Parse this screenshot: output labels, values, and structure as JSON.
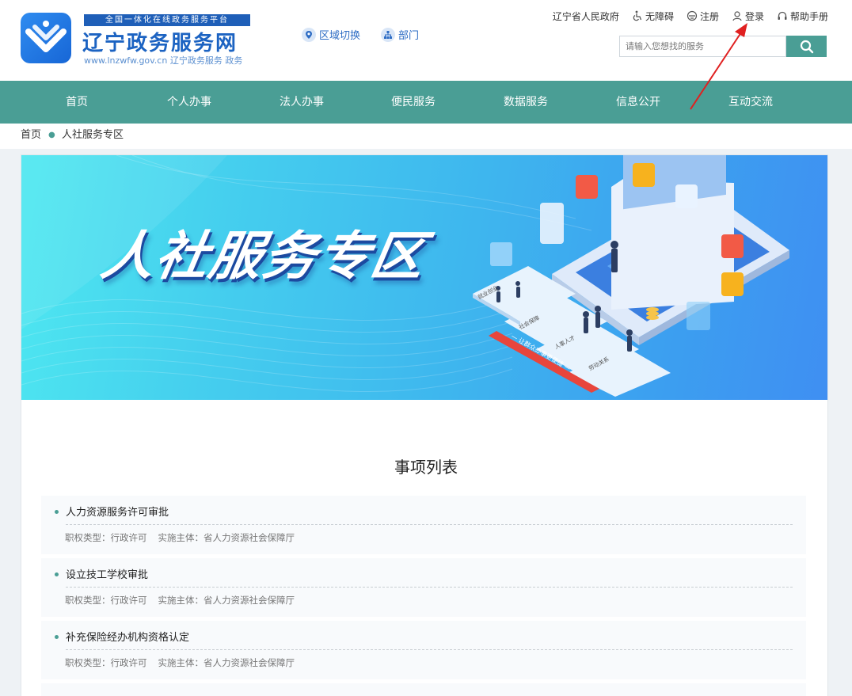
{
  "header": {
    "logo_tagline": "全国一体化在线政务服务平台",
    "logo_title": "辽宁政务服务网",
    "logo_url": "www.lnzwfw.gov.cn  辽宁政务服务 政务",
    "region_switch": "区域切换",
    "department": "部门",
    "toplinks": {
      "gov": "辽宁省人民政府",
      "accessible": "无障碍",
      "register": "注册",
      "login": "登录",
      "help": "帮助手册"
    },
    "search": {
      "placeholder": "请输入您想找的服务"
    }
  },
  "nav": {
    "items": [
      "首页",
      "个人办事",
      "法人办事",
      "便民服务",
      "数据服务",
      "信息公开",
      "互动交流"
    ]
  },
  "breadcrumb": {
    "home": "首页",
    "current": "人社服务专区"
  },
  "banner": {
    "title": "人社服务专区",
    "ribbon": "让群众办事更便捷",
    "tiles": [
      "就业创业",
      "社会保障",
      "人事人才",
      "劳动关系"
    ]
  },
  "list": {
    "title": "事项列表",
    "meta_type_label": "职权类型：",
    "meta_body_label": "实施主体：",
    "items": [
      {
        "name": "人力资源服务许可审批",
        "type": "行政许可",
        "body": "省人力资源社会保障厅"
      },
      {
        "name": "设立技工学校审批",
        "type": "行政许可",
        "body": "省人力资源社会保障厅"
      },
      {
        "name": "补充保险经办机构资格认定",
        "type": "行政许可",
        "body": "省人力资源社会保障厅"
      }
    ]
  },
  "colors": {
    "primary": "#4a9e95",
    "brand_blue": "#1c63c2",
    "annotation_arrow": "#e02020"
  },
  "icons": [
    "location-icon",
    "department-icon",
    "accessible-icon",
    "register-icon",
    "user-icon",
    "headset-icon",
    "search-icon"
  ]
}
